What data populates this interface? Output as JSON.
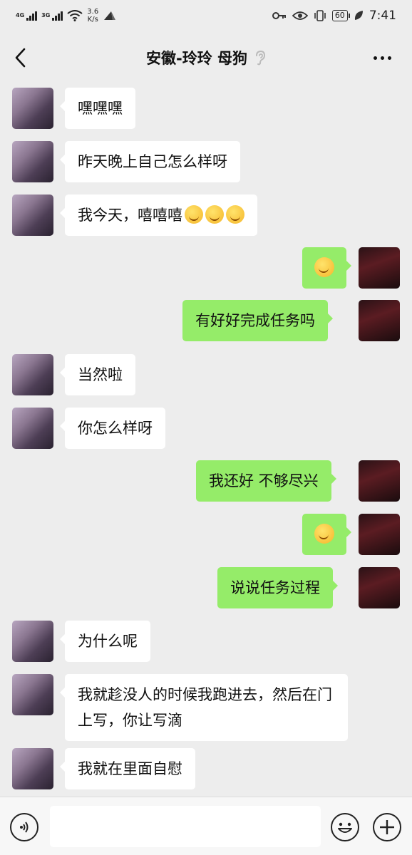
{
  "status_bar": {
    "net1": "4G",
    "net2": "3G",
    "speed_value": "3.6",
    "speed_unit": "K/s",
    "battery": "60",
    "time": "7:41"
  },
  "header": {
    "title": "安徽-玲玲 母狗"
  },
  "messages": [
    {
      "side": "in",
      "text": "嘿嘿嘿"
    },
    {
      "side": "in",
      "text": "昨天晚上自己怎么样呀"
    },
    {
      "side": "in",
      "text": "我今天，嘻嘻嘻",
      "emoji": "grin-emoji x3"
    },
    {
      "side": "out",
      "emoji": "thinking-emoji"
    },
    {
      "side": "out",
      "text": "有好好完成任务吗"
    },
    {
      "side": "in",
      "text": "当然啦"
    },
    {
      "side": "in",
      "text": "你怎么样呀"
    },
    {
      "side": "out",
      "text": "我还好 不够尽兴"
    },
    {
      "side": "out",
      "emoji": "laughing-tears-emoji"
    },
    {
      "side": "out",
      "text": "说说任务过程"
    },
    {
      "side": "in",
      "text": "为什么呢"
    },
    {
      "side": "in",
      "text": "我就趁没人的时候我跑进去，然后在门上写，你让写滴"
    },
    {
      "side": "in",
      "text": "我就在里面自慰"
    }
  ],
  "colors": {
    "background": "#ededed",
    "incoming_bubble": "#ffffff",
    "outgoing_bubble": "#95ec69"
  },
  "icons": {
    "back": "back-arrow-icon",
    "ear": "ear-icon",
    "more": "more-icon",
    "voice": "voice-icon",
    "sticker": "sticker-icon",
    "plus": "plus-icon"
  }
}
